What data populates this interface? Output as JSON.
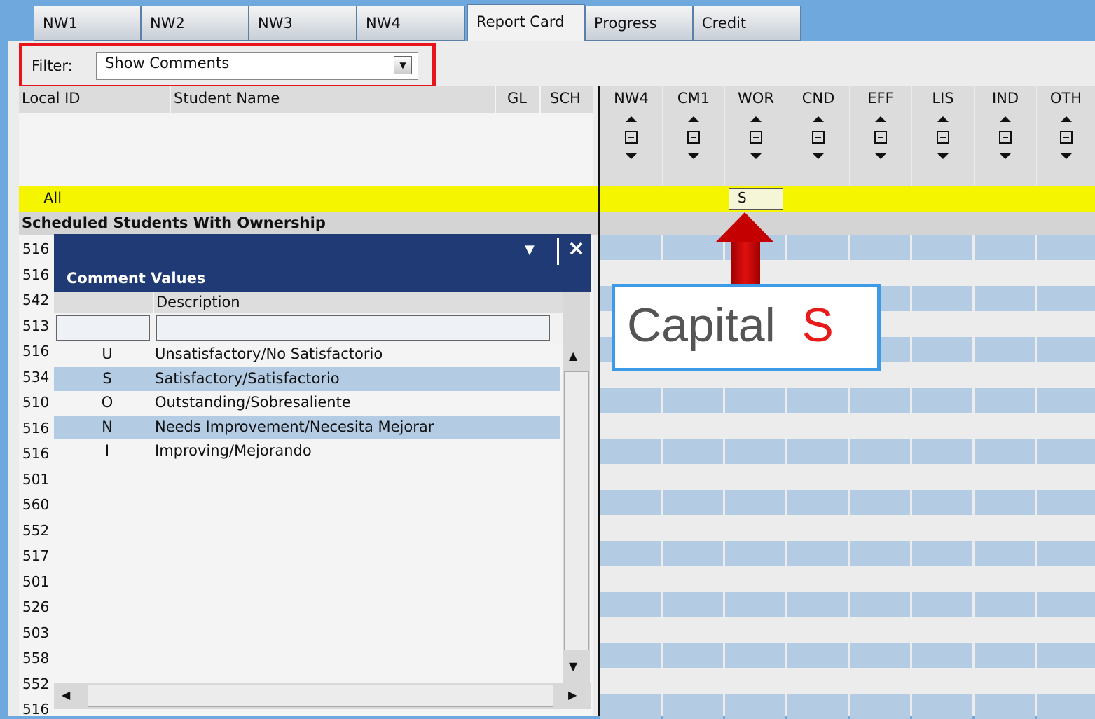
{
  "tabs": [
    "NW1",
    "NW2",
    "NW3",
    "NW4",
    "Report Card",
    "Progress",
    "Credit"
  ],
  "active_tab": "Report Card",
  "filter": {
    "label": "Filter:",
    "value": "Show Comments"
  },
  "left_headers": {
    "local_id": "Local ID",
    "student_name": "Student Name",
    "gl": "GL",
    "sch": "SCH"
  },
  "grade_columns": [
    "NW4",
    "CM1",
    "WOR",
    "CND",
    "EFF",
    "LIS",
    "IND",
    "OTH"
  ],
  "all_row": {
    "label": "All",
    "wor_value": "S"
  },
  "section_label": "Scheduled Students With Ownership",
  "student_ids": [
    "516",
    "516",
    "542",
    "513",
    "516",
    "534",
    "510",
    "516",
    "516",
    "501",
    "560",
    "552",
    "517",
    "501",
    "526",
    "503",
    "558",
    "552",
    "516"
  ],
  "popup": {
    "caption": "Comment Values",
    "description_header": "Description",
    "rows": [
      {
        "code": "U",
        "desc": "Unsatisfactory/No Satisfactorio"
      },
      {
        "code": "S",
        "desc": "Satisfactory/Satisfactorio"
      },
      {
        "code": "O",
        "desc": "Outstanding/Sobresaliente"
      },
      {
        "code": "N",
        "desc": "Needs Improvement/Necesita Mejorar"
      },
      {
        "code": "I",
        "desc": "Improving/Mejorando"
      }
    ]
  },
  "callout": {
    "text": "Capital",
    "letter": "S"
  },
  "colors": {
    "accent_red": "#e8141b",
    "callout_blue": "#3c9ae6",
    "popup_navy": "#1f3a74",
    "row_blue": "#b4cbe4",
    "highlight_yellow": "#f5f500"
  }
}
